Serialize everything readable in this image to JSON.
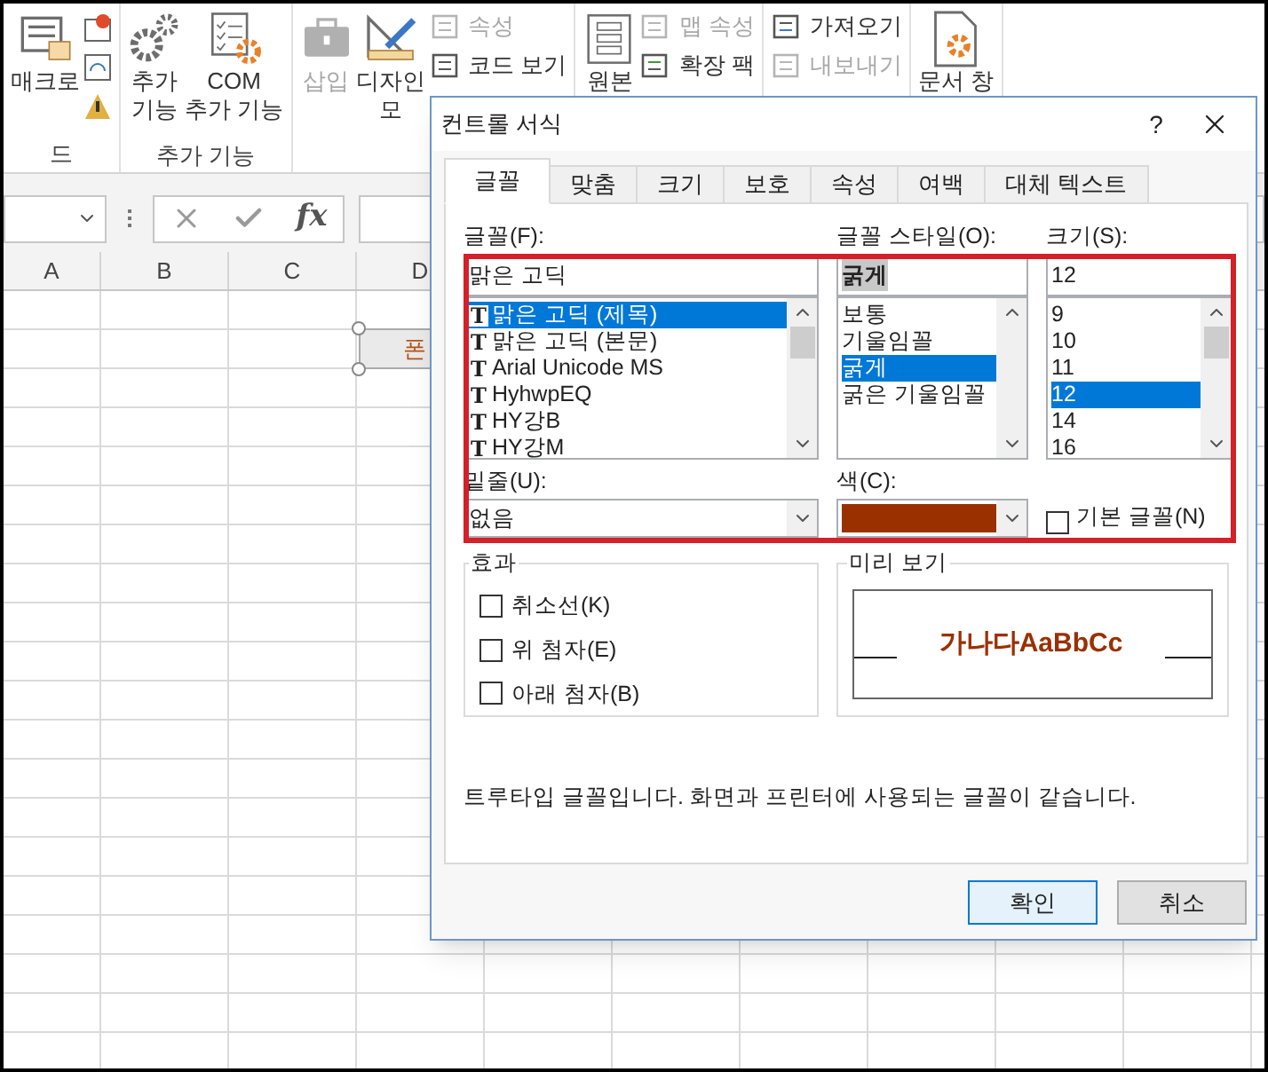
{
  "ribbon": {
    "groups": [
      {
        "label": "드",
        "large": [
          {
            "label": "매크로",
            "disabled": false
          }
        ]
      },
      {
        "label": "추가 기능",
        "large": [
          {
            "label": "추가\n기능",
            "disabled": false
          },
          {
            "label": "COM\n추가 기능",
            "disabled": false
          }
        ]
      },
      {
        "large": [
          {
            "label": "삽입",
            "disabled": true
          },
          {
            "label": "디자인\n모",
            "disabled": false
          }
        ],
        "small": [
          {
            "label": "속성",
            "disabled": true
          },
          {
            "label": "코드 보기",
            "disabled": false
          }
        ]
      },
      {
        "large": [
          {
            "label": "원본",
            "disabled": false
          }
        ],
        "small": [
          {
            "label": "맵 속성",
            "disabled": true
          },
          {
            "label": "확장 팩",
            "disabled": false
          }
        ]
      },
      {
        "small": [
          {
            "label": "가져오기",
            "disabled": false
          },
          {
            "label": "내보내기",
            "disabled": true
          }
        ]
      },
      {
        "large": [
          {
            "label": "문서 창",
            "disabled": false
          }
        ]
      }
    ]
  },
  "formula_bar": {
    "function_label": "fx"
  },
  "sheet": {
    "columns": [
      "A",
      "B",
      "C",
      "D"
    ],
    "form_button": {
      "label": "폰"
    }
  },
  "dialog": {
    "title": "컨트롤 서식",
    "help": "?",
    "tabs": [
      {
        "label": "글꼴",
        "selected": true
      },
      {
        "label": "맞춤",
        "selected": false
      },
      {
        "label": "크기",
        "selected": false
      },
      {
        "label": "보호",
        "selected": false
      },
      {
        "label": "속성",
        "selected": false
      },
      {
        "label": "여백",
        "selected": false
      },
      {
        "label": "대체 텍스트",
        "selected": false
      }
    ],
    "font": {
      "label": "글꼴(F):",
      "value": "맑은 고딕",
      "items": [
        {
          "type_mark": "T",
          "label": "맑은 고딕 (제목)",
          "selected": true
        },
        {
          "type_mark": "T",
          "label": "맑은 고딕 (본문)",
          "selected": false
        },
        {
          "type_mark": "T",
          "label": "Arial Unicode MS",
          "selected": false
        },
        {
          "type_mark": "T",
          "label": "HyhwpEQ",
          "selected": false
        },
        {
          "type_mark": "T",
          "label": "HY강B",
          "selected": false
        },
        {
          "type_mark": "T",
          "label": "HY강M",
          "selected": false
        }
      ]
    },
    "style": {
      "label": "글꼴 스타일(O):",
      "value": "굵게",
      "items": [
        {
          "label": "보통",
          "selected": false
        },
        {
          "label": "기울임꼴",
          "selected": false
        },
        {
          "label": "굵게",
          "selected": true
        },
        {
          "label": "굵은 기울임꼴",
          "selected": false
        }
      ]
    },
    "size": {
      "label": "크기(S):",
      "value": "12",
      "items": [
        {
          "label": "9",
          "selected": false
        },
        {
          "label": "10",
          "selected": false
        },
        {
          "label": "11",
          "selected": false
        },
        {
          "label": "12",
          "selected": true
        },
        {
          "label": "14",
          "selected": false
        },
        {
          "label": "16",
          "selected": false
        }
      ]
    },
    "underline": {
      "label": "밑줄(U):",
      "value": "없음"
    },
    "font_color": {
      "label": "색(C):",
      "color": "#9a3000"
    },
    "default_font": {
      "label": "기본 글꼴(N)",
      "checked": false
    },
    "effects": {
      "title": "효과",
      "items": [
        {
          "label": "취소선(K)",
          "checked": false
        },
        {
          "label": "위 첨자(E)",
          "checked": false
        },
        {
          "label": "아래 첨자(B)",
          "checked": false
        }
      ]
    },
    "preview": {
      "title": "미리 보기",
      "sample": "가나다AaBbCc"
    },
    "info": "트루타입 글꼴입니다. 화면과 프린터에 사용되는 글꼴이 같습니다.",
    "buttons": [
      {
        "label": "확인",
        "focused": true
      },
      {
        "label": "취소",
        "focused": false
      }
    ]
  }
}
